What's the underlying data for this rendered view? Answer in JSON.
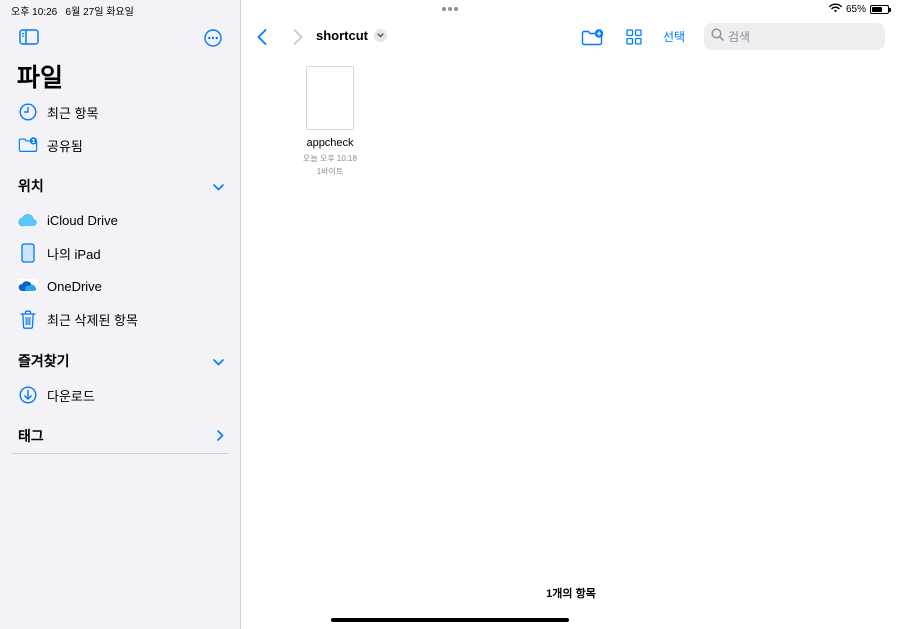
{
  "status": {
    "time": "오후 10:26",
    "date": "6월 27일 화요일",
    "battery": "65%",
    "battery_level": 0.65
  },
  "sidebar": {
    "title": "파일",
    "items_top": [
      {
        "label": "최근 항목",
        "icon": "clock-icon"
      },
      {
        "label": "공유됨",
        "icon": "shared-folder-icon"
      }
    ],
    "locations_header": "위치",
    "locations": [
      {
        "label": "iCloud Drive",
        "icon": "icloud-icon"
      },
      {
        "label": "나의 iPad",
        "icon": "ipad-icon"
      },
      {
        "label": "OneDrive",
        "icon": "onedrive-icon"
      },
      {
        "label": "최근 삭제된 항목",
        "icon": "trash-icon"
      }
    ],
    "favorites_header": "즐겨찾기",
    "favorites": [
      {
        "label": "다운로드",
        "icon": "download-icon"
      }
    ],
    "tags_header": "태그"
  },
  "toolbar": {
    "folder_title": "shortcut",
    "select_label": "선택",
    "search_placeholder": "검색"
  },
  "files": [
    {
      "name": "appcheck",
      "date": "오늘 오후 10:18",
      "size": "1바이트"
    }
  ],
  "footer": {
    "item_count": "1개의 항목"
  },
  "colors": {
    "accent": "#007aff",
    "sidebar_bg": "#f2f2f7"
  }
}
